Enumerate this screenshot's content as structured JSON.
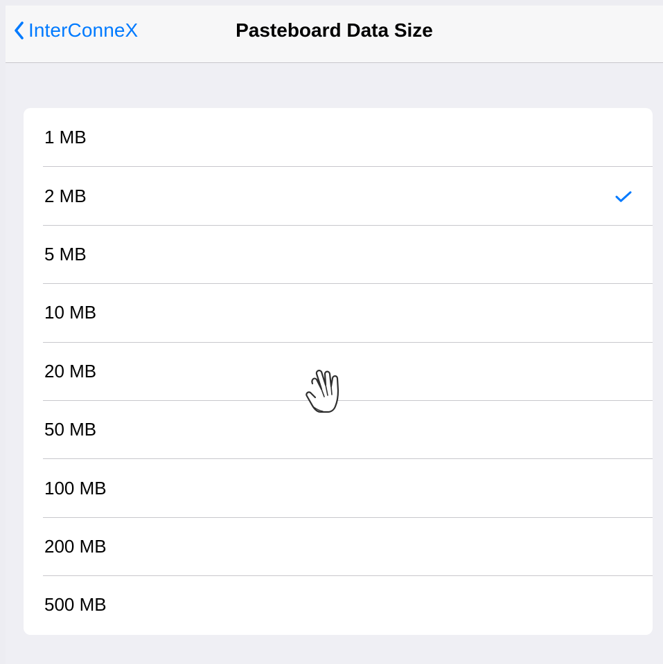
{
  "navigation": {
    "back_label": "InterConneX",
    "title": "Pasteboard Data Size"
  },
  "list": {
    "items": [
      {
        "label": "1 MB",
        "selected": false
      },
      {
        "label": "2 MB",
        "selected": true
      },
      {
        "label": "5 MB",
        "selected": false
      },
      {
        "label": "10 MB",
        "selected": false
      },
      {
        "label": "20 MB",
        "selected": false
      },
      {
        "label": "50 MB",
        "selected": false
      },
      {
        "label": "100 MB",
        "selected": false
      },
      {
        "label": "200 MB",
        "selected": false
      },
      {
        "label": "500 MB",
        "selected": false
      }
    ]
  },
  "icons": {
    "back": "chevron-left-icon",
    "selected": "checkmark-icon",
    "pointer": "hand-pointer-icon"
  },
  "colors": {
    "accent": "#007aff",
    "page_background": "#efeff4",
    "navbar_background": "#f7f7f8",
    "card_background": "#ffffff",
    "separator": "#c8c7cc"
  }
}
